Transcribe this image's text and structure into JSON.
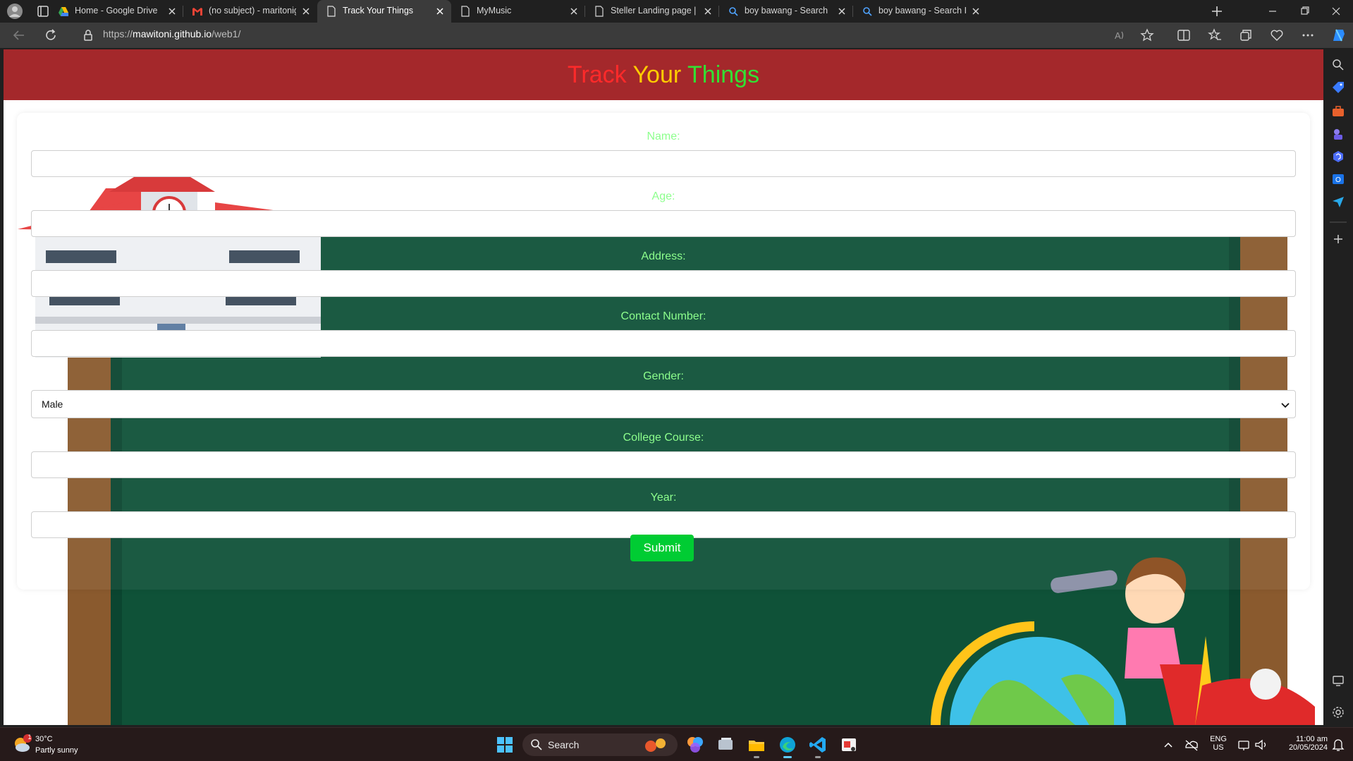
{
  "browser": {
    "tabs": [
      {
        "label": "Home - Google Drive",
        "icon": "google-drive-icon",
        "active": false
      },
      {
        "label": "(no subject) - maritonigallardo(",
        "icon": "gmail-icon",
        "active": false
      },
      {
        "label": "Track Your Things",
        "icon": "page-icon",
        "active": true
      },
      {
        "label": "MyMusic",
        "icon": "page-icon",
        "active": false
      },
      {
        "label": "Steller Landing page | Free Boo",
        "icon": "page-icon",
        "active": false
      },
      {
        "label": "boy bawang - Search",
        "icon": "bing-search-icon",
        "active": false
      },
      {
        "label": "boy bawang - Search Images",
        "icon": "bing-search-icon",
        "active": false
      }
    ],
    "url_prefix": "https://",
    "url_host": "mawitoni.github.io",
    "url_path": "/web1/"
  },
  "page": {
    "title_words": [
      "Track",
      "Your",
      "Things"
    ],
    "title_colors": [
      "#ff2a2a",
      "#ffcc00",
      "#33e033"
    ],
    "header_bg": "#a4282b",
    "form": {
      "name_label": "Name:",
      "age_label": "Age:",
      "address_label": "Address:",
      "contact_label": "Contact Number:",
      "gender_label": "Gender:",
      "gender_value": "Male",
      "course_label": "College Course:",
      "year_label": "Year:",
      "submit_label": "Submit",
      "label_color": "#8dff8d",
      "submit_color": "#00cc33"
    }
  },
  "taskbar": {
    "weather_temp": "30°C",
    "weather_condition": "Partly sunny",
    "weather_badge": "1",
    "search_label": "Search",
    "lang_top": "ENG",
    "lang_bottom": "US",
    "time": "11:00 am",
    "date": "20/05/2024"
  }
}
